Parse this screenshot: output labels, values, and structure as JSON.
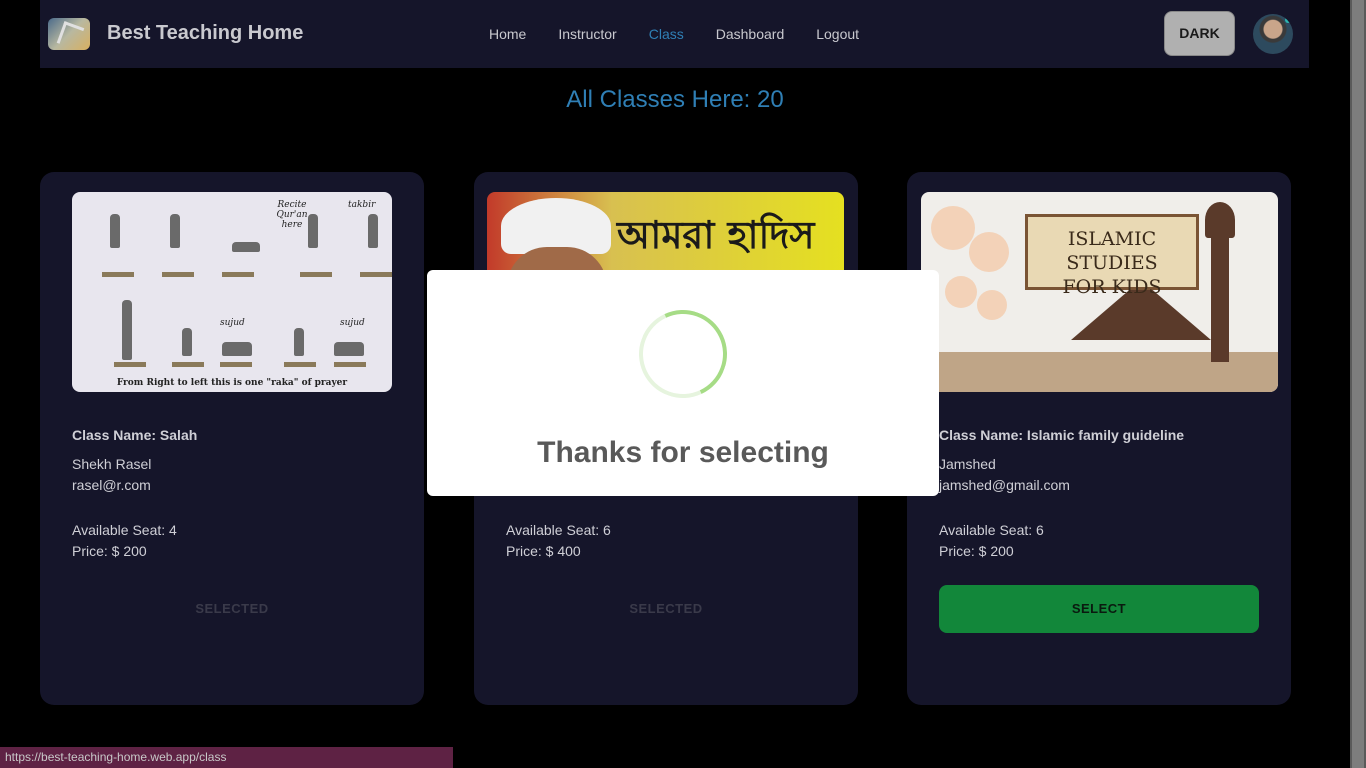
{
  "app": {
    "brand": "Best Teaching Home",
    "logo_icon": "graduation-logo-icon"
  },
  "nav": {
    "items": [
      {
        "label": "Home",
        "active": false
      },
      {
        "label": "Instructor",
        "active": false
      },
      {
        "label": "Class",
        "active": true
      },
      {
        "label": "Dashboard",
        "active": false
      },
      {
        "label": "Logout",
        "active": false
      }
    ],
    "theme_button": "DARK",
    "active_color": "#2f7fb5"
  },
  "main": {
    "heading": "All Classes Here: 20"
  },
  "cards": [
    {
      "class_name": "Class Name: Salah",
      "instructor": "Shekh Rasel",
      "email": "rasel@r.com",
      "seats": "Available Seat: 4",
      "price": "Price: $ 200",
      "button": "SELECTED",
      "image_text": {
        "t1": "Recite Qur'an here",
        "t2": "takbir",
        "t3": "sujud",
        "t4": "sujud",
        "caption": "From Right to left this is one \"raka\" of prayer"
      }
    },
    {
      "class_name": "",
      "instructor": "",
      "email": "",
      "seats": "Available Seat: 6",
      "price": "Price: $ 400",
      "button": "SELECTED",
      "image_text": {
        "bengali": "আমরা হাদিস মানতে বাধ্য"
      }
    },
    {
      "class_name": "Class Name: Islamic family guideline",
      "instructor": "Jamshed",
      "email": "jamshed@gmail.com",
      "seats": "Available Seat: 6",
      "price": "Price: $ 200",
      "button": "SELECT",
      "button_color": "#12873a",
      "image_text": {
        "line1": "ISLAMIC STUDIES",
        "line2": "FOR KIDS"
      }
    }
  ],
  "modal": {
    "title": "Thanks for selecting",
    "spinner_color": "#a6dc86"
  },
  "statusbar": {
    "url": "https://best-teaching-home.web.app/class"
  }
}
